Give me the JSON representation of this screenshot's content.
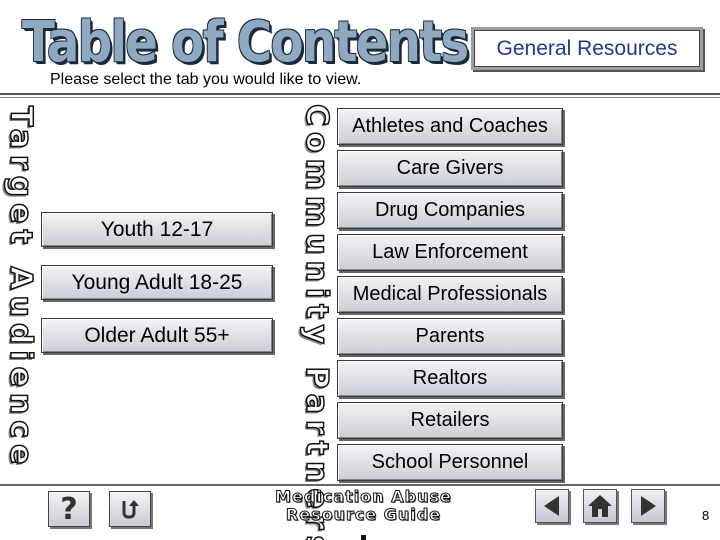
{
  "header": {
    "title": "Table of Contents",
    "subtitle": "Please select the tab you would like to view.",
    "general_resources_label": "General  Resources"
  },
  "target_audience": {
    "label": "Target Audience",
    "items": [
      {
        "label": "Youth 12-17"
      },
      {
        "label": "Young Adult 18-25"
      },
      {
        "label": "Older Adult 55+"
      }
    ]
  },
  "community_partners": {
    "label": "Community Partners",
    "items": [
      {
        "label": "Athletes and Coaches"
      },
      {
        "label": "Care Givers"
      },
      {
        "label": "Drug Companies"
      },
      {
        "label": "Law Enforcement"
      },
      {
        "label": "Medical Professionals"
      },
      {
        "label": "Parents"
      },
      {
        "label": "Realtors"
      },
      {
        "label": "Retailers"
      },
      {
        "label": "School Personnel"
      }
    ]
  },
  "footer": {
    "help_symbol": "?",
    "brand_line1": "Medication Abuse",
    "brand_line2": "Resource Guide",
    "page_number": "8"
  },
  "colors": {
    "title_fill": "#8fa9c0",
    "general_resources_text": "#233a86",
    "button_gradient_top": "#f1f3f5",
    "button_gradient_bottom": "#c9cfd6"
  },
  "icons": [
    "help-icon",
    "return-icon",
    "arrow-left-icon",
    "home-icon",
    "arrow-right-icon"
  ]
}
